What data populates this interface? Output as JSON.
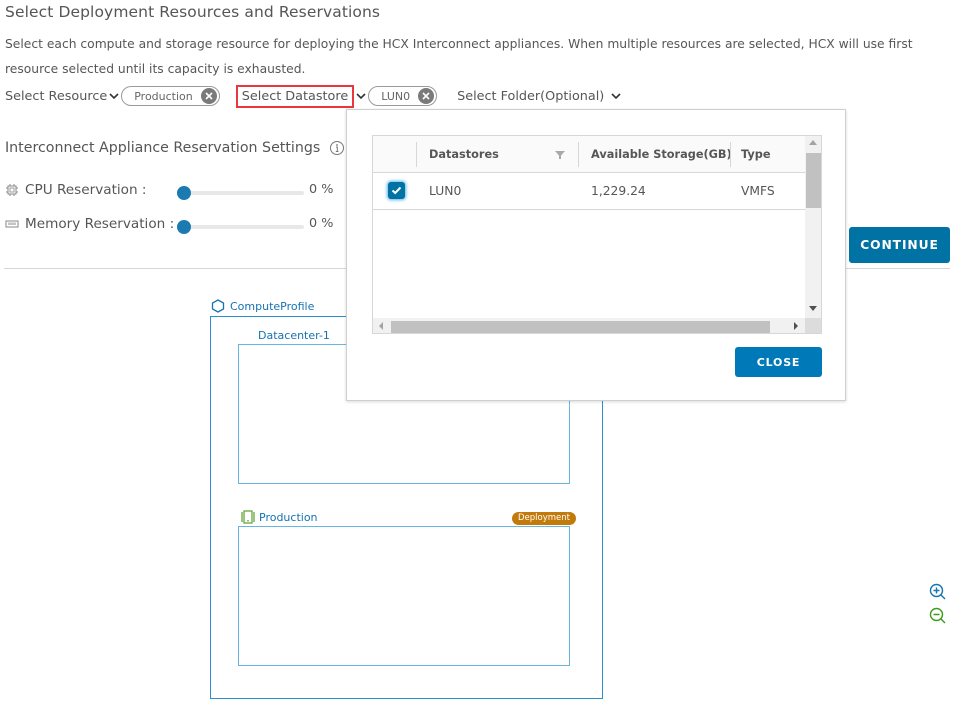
{
  "header": {
    "title": "Select Deployment Resources and Reservations",
    "description": "Select each compute and storage resource for deploying the HCX Interconnect appliances. When multiple resources are selected, HCX will use first resource selected until its capacity is exhausted."
  },
  "selectors": {
    "resource": {
      "label": "Select Resource",
      "selected": "Production"
    },
    "datastore": {
      "label": "Select Datastore",
      "selected": "LUN0"
    },
    "folder": {
      "label": "Select Folder(Optional)"
    }
  },
  "reservation": {
    "title": "Interconnect Appliance Reservation Settings",
    "cpu": {
      "label": "CPU Reservation :",
      "value_percent": 0,
      "display": "0 %"
    },
    "memory": {
      "label": "Memory Reservation :",
      "value_percent": 0,
      "display": "0 %"
    }
  },
  "continue_label": "CONTINUE",
  "datastore_popup": {
    "columns": [
      "Datastores",
      "Available Storage(GB)",
      "Type"
    ],
    "rows": [
      {
        "checked": true,
        "name": "LUN0",
        "available": "1,229.24",
        "type": "VMFS"
      }
    ],
    "close_label": "CLOSE"
  },
  "topology": {
    "compute_profile": "ComputeProfile",
    "datacenter": "Datacenter-1",
    "cluster": "Production",
    "badge": "Deployment"
  },
  "colors": {
    "primary": "#0072a3",
    "highlight": "#e8383d",
    "badge": "#c27b0b",
    "topology_line": "#2b8fcb",
    "zoom_in": "#1673b1",
    "zoom_out": "#3d9a1b"
  }
}
